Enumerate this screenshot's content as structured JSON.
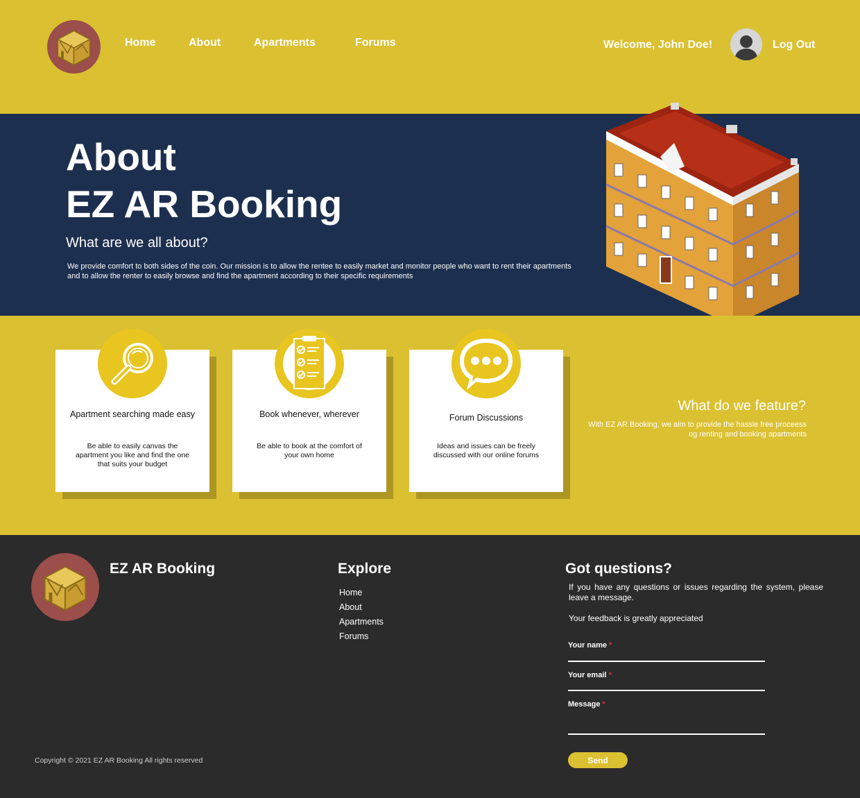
{
  "header": {
    "nav": [
      "Home",
      "About",
      "Apartments",
      "Forums"
    ],
    "welcome": "Welcome, John Doe!",
    "logout": "Log Out"
  },
  "hero": {
    "title_line1": "About",
    "title_line2": "EZ AR Booking",
    "subtitle": "What are we all about?",
    "text": "We provide comfort to both sides of the coin. Our mission is to allow the rentee to easily market and monitor people who want to rent their apartments and to allow the renter to easily browse and find the apartment according to their specific requirements"
  },
  "features": {
    "cards": [
      {
        "icon": "magnifying-glass-icon",
        "title": "Apartment searching made easy",
        "desc": "Be able to easily canvas the apartment you like and find the one that suits your budget"
      },
      {
        "icon": "clipboard-checklist-icon",
        "title": "Book whenever, wherever",
        "desc": "Be able to book at the comfort of your own home"
      },
      {
        "icon": "chat-bubble-icon",
        "title": "Forum Discussions",
        "desc": "Ideas and issues can be freely discussed with our online forums"
      }
    ],
    "heading": "What do we feature?",
    "text": "With EZ AR Booking, we aim to provide the hassle free proceess og renting and booking apartments"
  },
  "footer": {
    "brand": "EZ AR Booking",
    "explore_title": "Explore",
    "explore_links": [
      "Home",
      "About",
      "Apartments",
      "Forums"
    ],
    "questions_title": "Got questions?",
    "questions_text": "If you have any questions or issues regarding the system, please leave a message.",
    "feedback_text": "Your feedback is greatly appreciated",
    "form": {
      "name_label": "Your name",
      "email_label": "Your email",
      "message_label": "Message",
      "required_mark": "*",
      "send_label": "Send"
    },
    "copyright": "Copyright © 2021 EZ AR Booking All rights reserved"
  },
  "colors": {
    "yellow": "#dbc031",
    "navy": "#1d2f4f",
    "footer_bg": "#2b2b2b",
    "logo_circle": "#9b4e4a",
    "required": "#e0322e"
  }
}
